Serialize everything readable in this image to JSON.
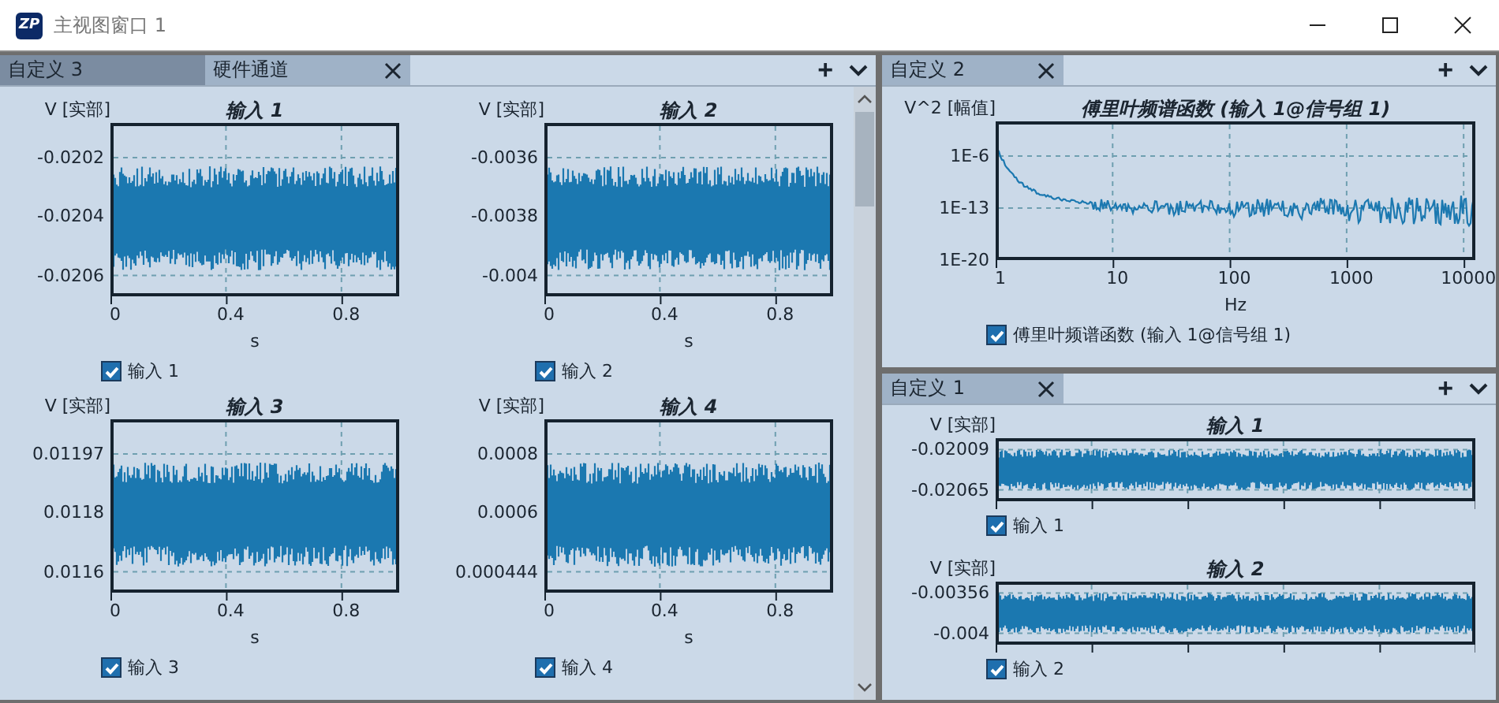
{
  "window": {
    "logo": "ZP",
    "title": "主视图窗口 1"
  },
  "left_pane": {
    "tabs": [
      {
        "label": "自定义 3",
        "selected": false
      },
      {
        "label": "硬件通道",
        "selected": true
      }
    ],
    "add": "+",
    "plots": [
      {
        "kind": "waveform",
        "ylabel": "V [实部]",
        "title": "输入 1",
        "yticks": [
          "-0.0202",
          "-0.0204",
          "-0.0206"
        ],
        "xticks": [
          "0",
          "0.4",
          "0.8"
        ],
        "xlabel": "s",
        "legend": {
          "label": "输入 1",
          "checked": true
        }
      },
      {
        "kind": "waveform",
        "ylabel": "V [实部]",
        "title": "输入 2",
        "yticks": [
          "-0.0036",
          "-0.0038",
          "-0.004"
        ],
        "xticks": [
          "0",
          "0.4",
          "0.8"
        ],
        "xlabel": "s",
        "legend": {
          "label": "输入 2",
          "checked": true
        }
      },
      {
        "kind": "waveform",
        "ylabel": "V [实部]",
        "title": "输入 3",
        "yticks": [
          "0.01197",
          "0.0118",
          "0.0116"
        ],
        "xticks": [
          "0",
          "0.4",
          "0.8"
        ],
        "xlabel": "s",
        "legend": {
          "label": "输入 3",
          "checked": true
        }
      },
      {
        "kind": "waveform",
        "ylabel": "V [实部]",
        "title": "输入 4",
        "yticks": [
          "0.0008",
          "0.0006",
          "0.000444"
        ],
        "xticks": [
          "0",
          "0.4",
          "0.8"
        ],
        "xlabel": "s",
        "legend": {
          "label": "输入 4",
          "checked": true
        }
      }
    ]
  },
  "right_top_pane": {
    "tabs": [
      {
        "label": "自定义 2",
        "selected": true
      }
    ],
    "add": "+",
    "plots": [
      {
        "kind": "spectrum",
        "ylabel": "V^2 [幅值]",
        "title": "傅里叶频谱函数 (输入 1@信号组 1)",
        "yticks": [
          "1E-6",
          "1E-13",
          "1E-20"
        ],
        "xticks": [
          "1",
          "10",
          "100",
          "1000",
          "10000"
        ],
        "xlabel": "Hz",
        "legend": {
          "label": "傅里叶频谱函数 (输入 1@信号组 1)",
          "checked": true
        }
      }
    ]
  },
  "right_bottom_pane": {
    "tabs": [
      {
        "label": "自定义 1",
        "selected": true
      }
    ],
    "add": "+",
    "plots": [
      {
        "kind": "strip",
        "ylabel": "V [实部]",
        "title": "输入 1",
        "yticks": [
          "-0.02009",
          "-0.02065"
        ],
        "legend": {
          "label": "输入 1",
          "checked": true
        }
      },
      {
        "kind": "strip",
        "ylabel": "V [实部]",
        "title": "输入 2",
        "yticks": [
          "-0.00356",
          "-0.004"
        ],
        "legend": {
          "label": "输入 2",
          "checked": true
        }
      }
    ]
  }
}
